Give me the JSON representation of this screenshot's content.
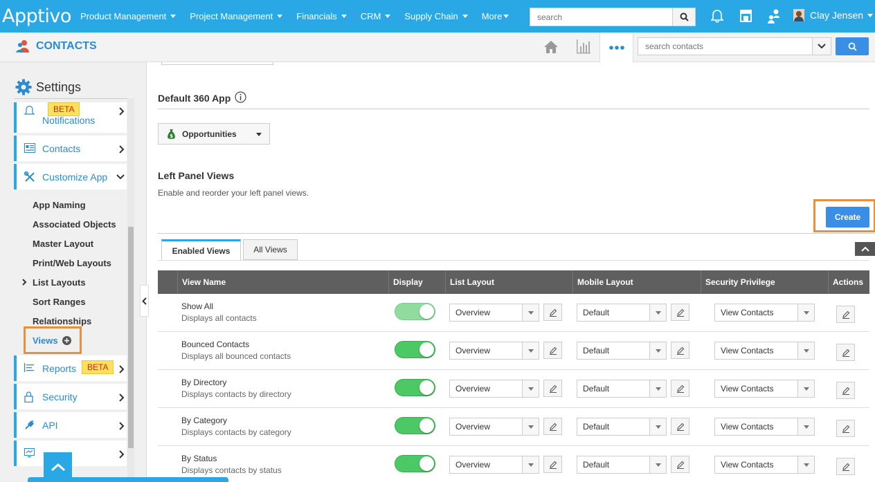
{
  "app": {
    "logo": "Apptivo",
    "module_title": "CONTACTS"
  },
  "topnav": {
    "items": [
      {
        "label": "Product Management"
      },
      {
        "label": "Project Management"
      },
      {
        "label": "Financials"
      },
      {
        "label": "CRM"
      },
      {
        "label": "Supply Chain"
      },
      {
        "label": "More"
      }
    ],
    "search_placeholder": "search",
    "user_name": "Clay Jensen",
    "icons": [
      "bell-icon",
      "store-icon",
      "users-icon",
      "avatar-icon"
    ]
  },
  "subbar": {
    "icons": [
      "home-icon",
      "bar-chart-icon",
      "more-dots-icon"
    ],
    "search_placeholder": "search contacts"
  },
  "sidebar": {
    "title": "Settings",
    "cards": [
      {
        "label": "Notifications",
        "badge": "BETA",
        "icon": "bell-icon"
      },
      {
        "label": "Contacts",
        "icon": "contacts-card-icon"
      },
      {
        "label": "Customize App",
        "icon": "tools-icon"
      },
      {
        "label": "Reports",
        "badge": "BETA",
        "icon": "report-icon"
      },
      {
        "label": "Security",
        "icon": "lock-icon"
      },
      {
        "label": "API",
        "icon": "plug-icon"
      },
      {
        "label": "",
        "icon": "chart-card-icon"
      }
    ],
    "customize_items": [
      {
        "label": "App Naming"
      },
      {
        "label": "Associated Objects"
      },
      {
        "label": "Master Layout"
      },
      {
        "label": "Print/Web Layouts"
      },
      {
        "label": "List Layouts"
      },
      {
        "label": "Sort Ranges"
      },
      {
        "label": "Relationships"
      },
      {
        "label": "Views"
      }
    ]
  },
  "main": {
    "default_app_title": "Default 360 App",
    "default_app_value": "Opportunities",
    "left_panel_title": "Left Panel Views",
    "left_panel_desc": "Enable and reorder your left panel views.",
    "create_label": "Create",
    "tabs": [
      {
        "label": "Enabled Views"
      },
      {
        "label": "All Views"
      }
    ],
    "table": {
      "headers": [
        "View Name",
        "Display",
        "List Layout",
        "Mobile Layout",
        "Security Privilege",
        "Actions"
      ],
      "rows": [
        {
          "name": "Show All",
          "desc": "Displays all contacts",
          "list_layout": "Overview",
          "mobile_layout": "Default",
          "security": "View Contacts"
        },
        {
          "name": "Bounced Contacts",
          "desc": "Displays all bounced contacts",
          "list_layout": "Overview",
          "mobile_layout": "Default",
          "security": "View Contacts"
        },
        {
          "name": "By Directory",
          "desc": "Displays contacts by directory",
          "list_layout": "Overview",
          "mobile_layout": "Default",
          "security": "View Contacts"
        },
        {
          "name": "By Category",
          "desc": "Displays contacts by category",
          "list_layout": "Overview",
          "mobile_layout": "Default",
          "security": "View Contacts"
        },
        {
          "name": "By Status",
          "desc": "Displays contacts by status",
          "list_layout": "Overview",
          "mobile_layout": "Default",
          "security": "View Contacts"
        }
      ]
    }
  },
  "colors": {
    "primary": "#2aa8e6",
    "link": "#2a8bd0",
    "button": "#3a8ee6",
    "highlight": "#e8913a",
    "toggle_on": "#4cc864",
    "badge_bg": "#fde15a",
    "badge_text": "#d0271d"
  }
}
